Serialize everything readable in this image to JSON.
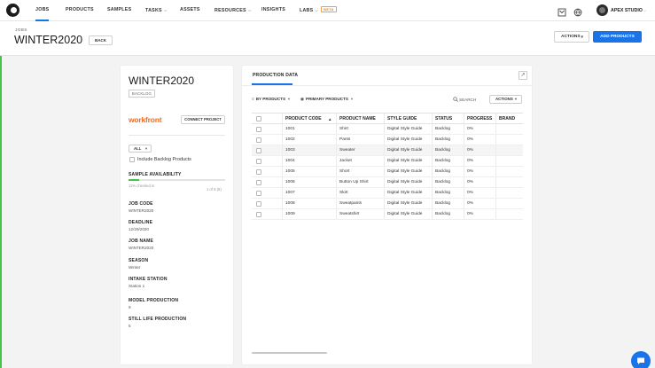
{
  "nav": {
    "items": [
      {
        "label": "JOBS",
        "active": true
      },
      {
        "label": "PRODUCTS"
      },
      {
        "label": "SAMPLES"
      },
      {
        "label": "TASKS",
        "has_menu": true
      },
      {
        "label": "ASSETS"
      },
      {
        "label": "RESOURCES",
        "has_menu": true
      },
      {
        "label": "INSIGHTS"
      },
      {
        "label": "LABS",
        "has_menu": true,
        "badge": "BETA"
      }
    ],
    "user": "APEX STUDIO"
  },
  "header": {
    "breadcrumb": "JOBS",
    "title": "WINTER2020",
    "back_label": "BACK",
    "actions_label": "ACTIONS",
    "add_products_label": "ADD PRODUCTS"
  },
  "job": {
    "title": "WINTER2020",
    "status": "BACKLOG",
    "integration": {
      "logo_text": "workfront",
      "connect_label": "CONNECT PROJECT"
    },
    "filter_value": "ALL",
    "include_backlog_label": "Include Backlog Products",
    "sample_availability": {
      "label": "SAMPLE AVAILABILITY",
      "note": "11% checked in",
      "count": "1 of 9 (8)",
      "progress": 0.11
    },
    "fields": [
      {
        "label": "JOB CODE",
        "value": "WINTER2020"
      },
      {
        "label": "DEADLINE",
        "value": "12/29/2020"
      },
      {
        "label": "JOB NAME",
        "value": "WINTER2020"
      },
      {
        "label": "SEASON",
        "value": "Winter"
      },
      {
        "label": "INTAKE STATION",
        "value": "Station 1"
      },
      {
        "label": "MODEL PRODUCTION",
        "value": "9"
      },
      {
        "label": "STILL LIFE PRODUCTION",
        "value": "5"
      }
    ]
  },
  "production": {
    "tab_label": "PRODUCTION DATA",
    "by_products_label": "BY PRODUCTS",
    "primary_products_label": "PRIMARY PRODUCTS",
    "search_label": "SEARCH",
    "actions_label": "ACTIONS",
    "columns": [
      "PRODUCT CODE",
      "PRODUCT NAME",
      "STYLE GUIDE",
      "STATUS",
      "PROGRESS",
      "BRAND"
    ],
    "rows": [
      {
        "code": "1001",
        "name": "Shirt",
        "style_guide": "Digital Style Guide",
        "status": "Backlog",
        "progress": "0%",
        "brand": ""
      },
      {
        "code": "1002",
        "name": "Pants",
        "style_guide": "Digital Style Guide",
        "status": "Backlog",
        "progress": "0%",
        "brand": ""
      },
      {
        "code": "1003",
        "name": "Sweater",
        "style_guide": "Digital Style Guide",
        "status": "Backlog",
        "progress": "0%",
        "brand": ""
      },
      {
        "code": "1004",
        "name": "Jacket",
        "style_guide": "Digital Style Guide",
        "status": "Backlog",
        "progress": "0%",
        "brand": ""
      },
      {
        "code": "1005",
        "name": "Short",
        "style_guide": "Digital Style Guide",
        "status": "Backlog",
        "progress": "0%",
        "brand": ""
      },
      {
        "code": "1006",
        "name": "Button Up Shirt",
        "style_guide": "Digital Style Guide",
        "status": "Backlog",
        "progress": "0%",
        "brand": ""
      },
      {
        "code": "1007",
        "name": "Skirt",
        "style_guide": "Digital Style Guide",
        "status": "Backlog",
        "progress": "0%",
        "brand": ""
      },
      {
        "code": "1008",
        "name": "Sweatpants",
        "style_guide": "Digital Style Guide",
        "status": "Backlog",
        "progress": "0%",
        "brand": ""
      },
      {
        "code": "1009",
        "name": "Sweatshirt",
        "style_guide": "Digital Style Guide",
        "status": "Backlog",
        "progress": "0%",
        "brand": ""
      }
    ]
  },
  "colors": {
    "accent": "#1a73e8",
    "success": "#45c44c",
    "workfront": "#f36a1d"
  }
}
